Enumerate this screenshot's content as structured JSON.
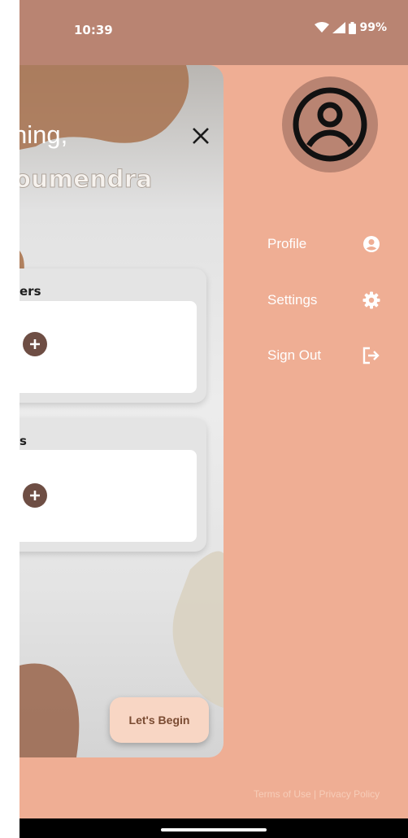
{
  "status_bar": {
    "time": "10:39",
    "battery": "99%"
  },
  "home": {
    "greeting": "ning,",
    "username": "oumendra",
    "sections": [
      {
        "title": "ers"
      },
      {
        "title": "s"
      }
    ],
    "begin_label": "Let's Begin"
  },
  "drawer": {
    "items": [
      {
        "label": "Profile",
        "icon": "account-circle-icon"
      },
      {
        "label": "Settings",
        "icon": "gear-icon"
      },
      {
        "label": "Sign Out",
        "icon": "logout-icon"
      }
    ],
    "terms": "Terms of Use",
    "separator": "|",
    "privacy": "Privacy Policy"
  },
  "colors": {
    "drawer_bg": "#efae94",
    "status_bar_bg": "#b98472",
    "accent_brown": "#6e4e44",
    "button_bg": "#f8d6c4"
  }
}
